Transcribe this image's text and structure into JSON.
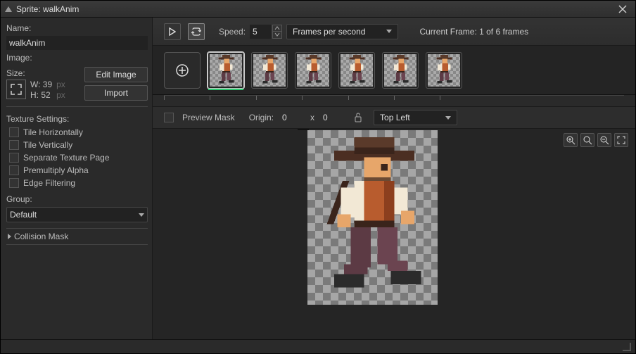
{
  "window": {
    "title": "Sprite: walkAnim"
  },
  "sidebar": {
    "name_label": "Name:",
    "name_value": "walkAnim",
    "image_label": "Image:",
    "size_label": "Size:",
    "width_label": "W: 39",
    "height_label": "H: 52",
    "px": "px",
    "edit_image_btn": "Edit Image",
    "import_btn": "Import",
    "texture_settings_label": "Texture Settings:",
    "tex_opts": [
      "Tile Horizontally",
      "Tile Vertically",
      "Separate Texture Page",
      "Premultiply Alpha",
      "Edge Filtering"
    ],
    "group_label": "Group:",
    "group_value": "Default",
    "collision_label": "Collision Mask"
  },
  "toolbar": {
    "speed_label": "Speed:",
    "speed_value": "5",
    "speed_unit": "Frames per second",
    "current_frame_label": "Current Frame: 1 of 6 frames"
  },
  "frames": {
    "count": 6,
    "selected": 0
  },
  "preview_bar": {
    "preview_mask_label": "Preview Mask",
    "origin_label": "Origin:",
    "origin_x": "0",
    "x_label": "x",
    "origin_y": "0",
    "anchor": "Top Left"
  }
}
